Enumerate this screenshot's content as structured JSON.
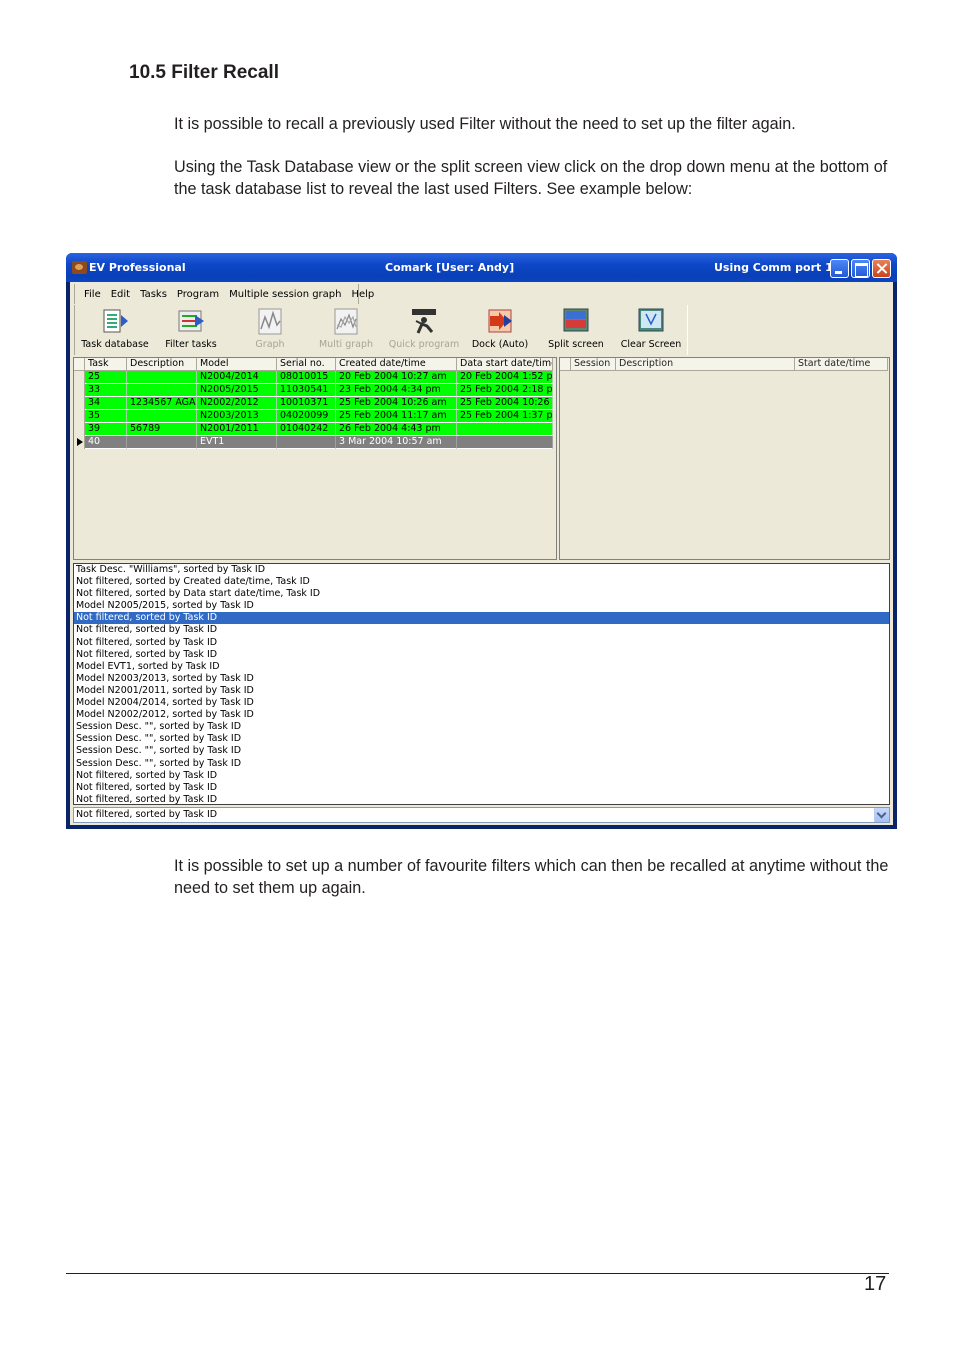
{
  "heading": "10.5 Filter Recall",
  "paragraphs": {
    "p1": "It is possible to recall a previously used Filter without the need to set up the filter again.",
    "p2": "Using the Task Database view or the split screen view click on the drop down menu at the bottom of the task database list to reveal the last used Filters. See example below:",
    "p3": "It is possible to set up a number of favourite filters which can then be recalled at anytime without the need to set them up again."
  },
  "page_number": "17",
  "window": {
    "app_title": "EV Professional",
    "center_title": "Comark [User: Andy]",
    "right_title": "Using Comm port 1"
  },
  "menu": [
    "File",
    "Edit",
    "Tasks",
    "Program",
    "Multiple session graph",
    "Help"
  ],
  "toolbar": [
    {
      "label": "Task database",
      "icon": "task-database-icon",
      "enabled": true
    },
    {
      "label": "Filter tasks",
      "icon": "filter-tasks-icon",
      "enabled": true
    },
    {
      "label": "Graph",
      "icon": "graph-icon",
      "enabled": false
    },
    {
      "label": "Multi graph",
      "icon": "multi-graph-icon",
      "enabled": false
    },
    {
      "label": "Quick program",
      "icon": "quick-program-icon",
      "enabled": false
    },
    {
      "label": "Dock (Auto)",
      "icon": "dock-icon",
      "enabled": true
    },
    {
      "label": "Split screen",
      "icon": "split-screen-icon",
      "enabled": true
    },
    {
      "label": "Clear Screen",
      "icon": "clear-screen-icon",
      "enabled": true
    }
  ],
  "task_grid": {
    "headers": [
      "Task",
      "Description",
      "Model",
      "Serial no.",
      "Created date/time",
      "Data start date/time"
    ],
    "rows": [
      {
        "cells": [
          "25",
          "",
          "N2004/2014",
          "08010015",
          "20 Feb 2004 10:27 am",
          "20 Feb 2004 1:52 pm"
        ],
        "state": "green"
      },
      {
        "cells": [
          "33",
          "",
          "N2005/2015",
          "11030541",
          "23 Feb 2004 4:34 pm",
          "25 Feb 2004 2:18 pm"
        ],
        "state": "green"
      },
      {
        "cells": [
          "34",
          "1234567 AGA I",
          "N2002/2012",
          "10010371",
          "25 Feb 2004 10:26 am",
          "25 Feb 2004 10:26 am"
        ],
        "state": "green"
      },
      {
        "cells": [
          "35",
          "",
          "N2003/2013",
          "04020099",
          "25 Feb 2004 11:17 am",
          "25 Feb 2004 1:37 pm"
        ],
        "state": "green"
      },
      {
        "cells": [
          "39",
          "56789",
          "N2001/2011",
          "01040242",
          "26 Feb 2004 4:43 pm",
          ""
        ],
        "state": "green"
      },
      {
        "cells": [
          "40",
          "",
          "EVT1",
          "",
          "3 Mar 2004 10:57 am",
          ""
        ],
        "state": "selected"
      }
    ]
  },
  "session_grid": {
    "headers": [
      "Session",
      "Description",
      "Start date/time"
    ]
  },
  "filter_list": {
    "items": [
      "Task Desc. \"Williams\", sorted by Task ID",
      "Not filtered, sorted by Created date/time, Task ID",
      "Not filtered, sorted by Data start date/time, Task ID",
      "Model N2005/2015, sorted by Task ID",
      "Not filtered, sorted by Task ID",
      "Not filtered, sorted by Task ID",
      "Not filtered, sorted by Task ID",
      "Not filtered, sorted by Task ID",
      "Model EVT1, sorted by Task ID",
      "Model N2003/2013, sorted by Task ID",
      "Model N2001/2011, sorted by Task ID",
      "Model N2004/2014, sorted by Task ID",
      "Model N2002/2012, sorted by Task ID",
      "Session Desc. \"\", sorted by Task ID",
      "Session Desc. \"\", sorted by Task ID",
      "Session Desc. \"\", sorted by Task ID",
      "Session Desc. \"\", sorted by Task ID",
      "Not filtered, sorted by Task ID",
      "Not filtered, sorted by Task ID",
      "Not filtered, sorted by Task ID"
    ],
    "selected_index": 4,
    "combo_value": "Not filtered, sorted by Task ID"
  },
  "colors": {
    "row_highlight": "#00ff00",
    "selection": "#316ac5",
    "titlebar": "#0a3fb8"
  }
}
